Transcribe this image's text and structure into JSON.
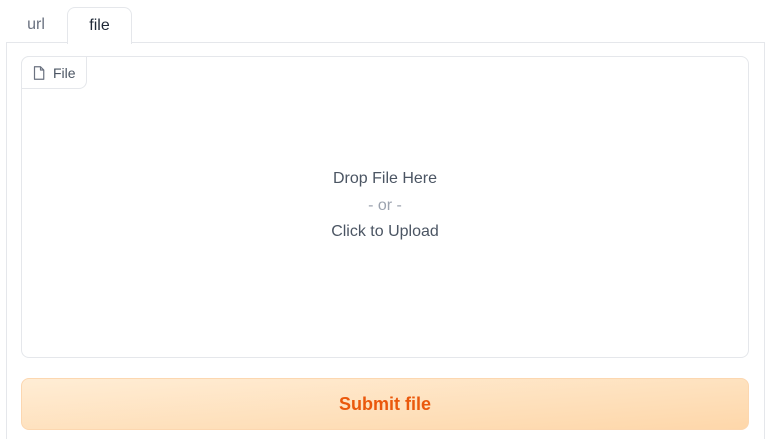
{
  "tabs": [
    {
      "label": "url",
      "selected": false
    },
    {
      "label": "file",
      "selected": true
    }
  ],
  "upload": {
    "field_label": "File",
    "field_icon": "file-icon",
    "drop_text": "Drop File Here",
    "or_text": "- or -",
    "click_text": "Click to Upload"
  },
  "submit": {
    "label": "Submit file"
  },
  "colors": {
    "accent_text": "#ea580c",
    "button_gradient_start": "#ffedd5",
    "button_gradient_end": "#fed7aa",
    "border": "#e5e7eb"
  }
}
